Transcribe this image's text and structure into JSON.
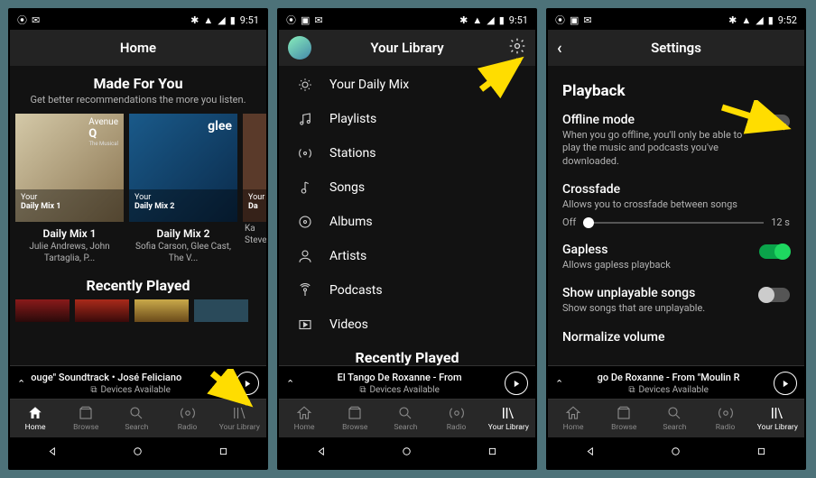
{
  "status": {
    "time": "9:51",
    "time3": "9:52"
  },
  "nav": {
    "home": "Home",
    "browse": "Browse",
    "search": "Search",
    "radio": "Radio",
    "library": "Your Library"
  },
  "now_playing": {
    "s1_title": "ouge\" Soundtrack • José Feliciano",
    "s2_title": "El Tango De Roxanne - From",
    "s3_title": "go De Roxanne - From \"Moulin R",
    "devices": "Devices Available"
  },
  "s1": {
    "header": "Home",
    "section1": {
      "title": "Made For You",
      "subtitle": "Get better recommendations the more you listen."
    },
    "daily_mix": [
      {
        "title": "Daily Mix 1",
        "sub": "Julie Andrews, John Tartaglia, P...",
        "stripe_top": "Your",
        "stripe_bot": "Daily Mix 1",
        "album": "Avenue Q"
      },
      {
        "title": "Daily Mix 2",
        "sub": "Sofia Carson, Glee Cast, The V...",
        "stripe_top": "Your",
        "stripe_bot": "Daily Mix 2",
        "album": "glee"
      },
      {
        "title": "",
        "sub": "Ka\nSteve",
        "stripe_top": "Your",
        "stripe_bot": "Da",
        "album": ""
      }
    ],
    "section2_title": "Recently Played"
  },
  "s2": {
    "header": "Your Library",
    "items": [
      {
        "label": "Your Daily Mix",
        "icon": "sun"
      },
      {
        "label": "Playlists",
        "icon": "note"
      },
      {
        "label": "Stations",
        "icon": "radio"
      },
      {
        "label": "Songs",
        "icon": "song"
      },
      {
        "label": "Albums",
        "icon": "album"
      },
      {
        "label": "Artists",
        "icon": "artist"
      },
      {
        "label": "Podcasts",
        "icon": "podcast"
      },
      {
        "label": "Videos",
        "icon": "video"
      }
    ],
    "recently": "Recently Played"
  },
  "s3": {
    "header": "Settings",
    "section": "Playback",
    "items": [
      {
        "key": "offline",
        "title": "Offline mode",
        "desc": "When you go offline, you'll only be able to play the music and podcasts you've downloaded.",
        "toggle": false
      },
      {
        "key": "crossfade",
        "title": "Crossfade",
        "desc": "Allows you to crossfade between songs",
        "slider": {
          "left": "Off",
          "right": "12 s"
        }
      },
      {
        "key": "gapless",
        "title": "Gapless",
        "desc": "Allows gapless playback",
        "toggle": true
      },
      {
        "key": "unplayable",
        "title": "Show unplayable songs",
        "desc": "Show songs that are unplayable.",
        "toggle": false
      },
      {
        "key": "normalize",
        "title": "Normalize volume",
        "desc": ""
      }
    ]
  }
}
